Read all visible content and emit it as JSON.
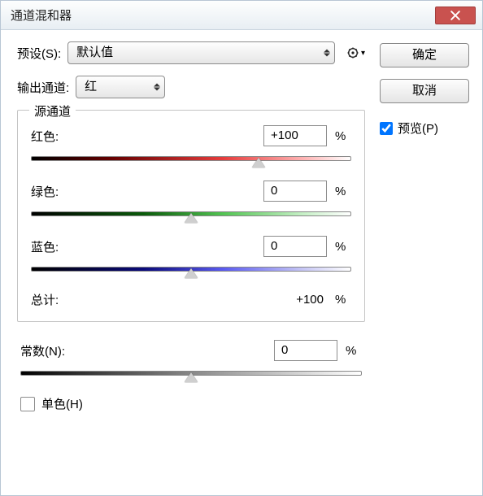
{
  "title": "通道混和器",
  "preset": {
    "label": "预设(S):",
    "value": "默认值"
  },
  "output": {
    "label": "输出通道:",
    "value": "红"
  },
  "source_group_label": "源通道",
  "channels": {
    "red": {
      "label": "红色:",
      "value": "+100",
      "unit": "%",
      "thumb_pct": 71
    },
    "green": {
      "label": "绿色:",
      "value": "0",
      "unit": "%",
      "thumb_pct": 50
    },
    "blue": {
      "label": "蓝色:",
      "value": "0",
      "unit": "%",
      "thumb_pct": 50
    }
  },
  "total": {
    "label": "总计:",
    "value": "+100",
    "unit": "%"
  },
  "constant": {
    "label": "常数(N):",
    "value": "0",
    "unit": "%",
    "thumb_pct": 50
  },
  "mono": {
    "label": "单色(H)",
    "checked": false
  },
  "buttons": {
    "ok": "确定",
    "cancel": "取消"
  },
  "preview": {
    "label": "预览(P)",
    "checked": true
  }
}
